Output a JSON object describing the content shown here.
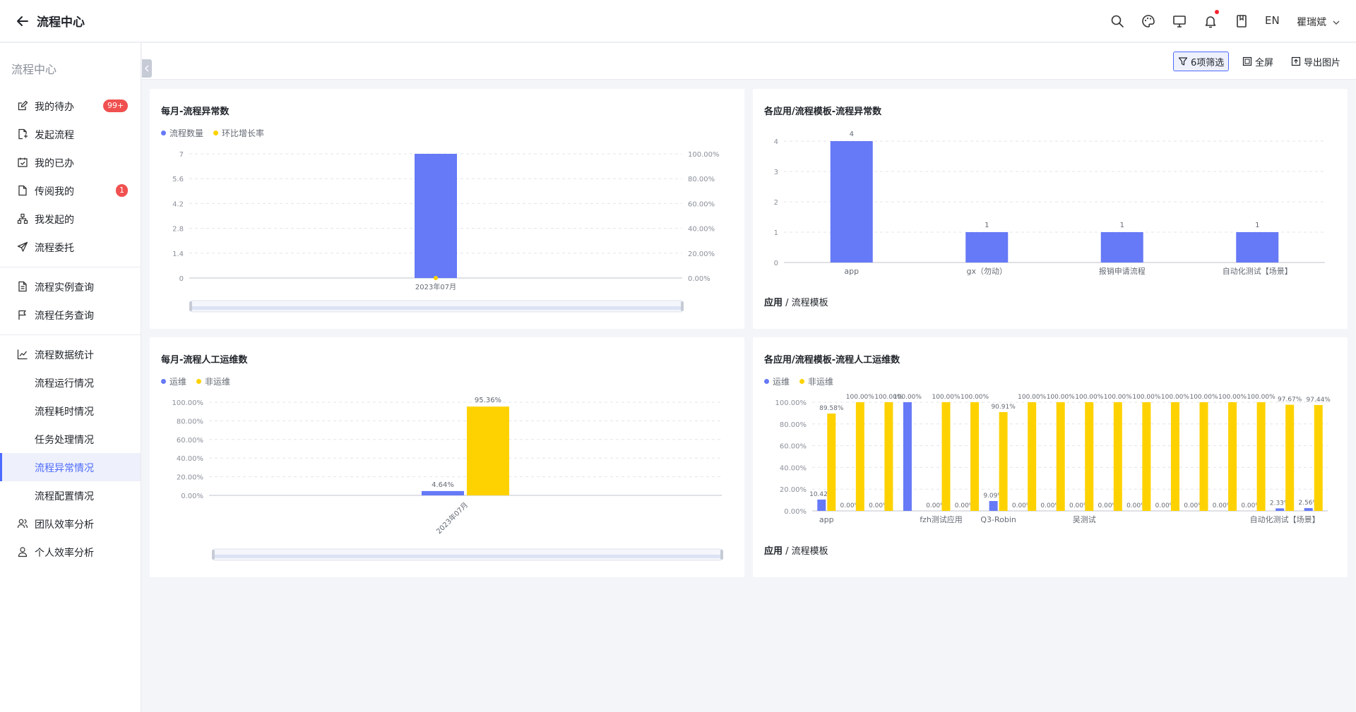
{
  "header": {
    "title": "流程中心",
    "lang": "EN",
    "user": "瞿瑞斌"
  },
  "sidebar": {
    "title": "流程中心",
    "items": [
      {
        "label": "我的待办",
        "badge": "99+",
        "icon": "edit-icon"
      },
      {
        "label": "发起流程",
        "icon": "file-start-icon"
      },
      {
        "label": "我的已办",
        "icon": "calendar-check-icon"
      },
      {
        "label": "传阅我的",
        "badge": "1",
        "icon": "document-icon"
      },
      {
        "label": "我发起的",
        "icon": "org-tree-icon"
      },
      {
        "label": "流程委托",
        "icon": "send-icon"
      },
      {
        "label": "流程实例查询",
        "icon": "doc-search-icon"
      },
      {
        "label": "流程任务查询",
        "icon": "flag-icon"
      },
      {
        "label": "流程数据统计",
        "icon": "line-chart-icon"
      },
      {
        "label": "流程运行情况"
      },
      {
        "label": "流程耗时情况"
      },
      {
        "label": "任务处理情况"
      },
      {
        "label": "流程异常情况"
      },
      {
        "label": "流程配置情况"
      },
      {
        "label": "团队效率分析",
        "icon": "team-icon"
      },
      {
        "label": "个人效率分析",
        "icon": "person-icon"
      }
    ]
  },
  "toolbar": {
    "filter_label": "6项筛选",
    "fullscreen_label": "全屏",
    "export_label": "导出图片"
  },
  "cards": {
    "c1": {
      "title": "每月-流程异常数",
      "legend": [
        "流程数量",
        "环比增长率"
      ]
    },
    "c2": {
      "title": "各应用/流程模板-流程异常数",
      "dim_bold": "应用",
      "dim_rest": " / 流程模板"
    },
    "c3": {
      "title": "每月-流程人工运维数",
      "legend": [
        "运维",
        "非运维"
      ]
    },
    "c4": {
      "title": "各应用/流程模板-流程人工运维数",
      "legend": [
        "运维",
        "非运维"
      ],
      "dim_bold": "应用",
      "dim_rest": " / 流程模板"
    }
  },
  "colors": {
    "accent": "#4d6bfe",
    "blue_series": "#6679f6",
    "yellow_series": "#fed200",
    "badge": "#f0504f"
  },
  "chart_data": [
    {
      "type": "bar",
      "title": "每月-流程异常数",
      "categories": [
        "2023年07月"
      ],
      "series": [
        {
          "name": "流程数量",
          "values": [
            7
          ]
        },
        {
          "name": "环比增长率",
          "values": [
            0
          ]
        }
      ],
      "y_ticks": [
        "0",
        "1.4",
        "2.8",
        "4.2",
        "5.6",
        "7"
      ],
      "y2_ticks": [
        "0.00%",
        "20.00%",
        "40.00%",
        "60.00%",
        "80.00%",
        "100.00%"
      ],
      "ylim": [
        0,
        7
      ]
    },
    {
      "type": "bar",
      "title": "各应用/流程模板-流程异常数",
      "categories": [
        "app",
        "gx（勿动）",
        "报销申请流程",
        "自动化测试【场景】"
      ],
      "values": [
        4,
        1,
        1,
        1
      ],
      "y_ticks": [
        "0",
        "1",
        "2",
        "3",
        "4"
      ],
      "ylim": [
        0,
        4
      ]
    },
    {
      "type": "bar",
      "title": "每月-流程人工运维数",
      "categories": [
        "2023年07月"
      ],
      "series": [
        {
          "name": "运维",
          "values": [
            4.64
          ],
          "labels": [
            "4.64%"
          ]
        },
        {
          "name": "非运维",
          "values": [
            95.36
          ],
          "labels": [
            "95.36%"
          ]
        }
      ],
      "y_ticks": [
        "0.00%",
        "20.00%",
        "40.00%",
        "60.00%",
        "80.00%",
        "100.00%"
      ],
      "ylim": [
        0,
        100
      ]
    },
    {
      "type": "bar",
      "title": "各应用/流程模板-流程人工运维数",
      "categories": [
        "app",
        "",
        "",
        "fzh测试应用",
        "",
        "",
        "Q3-Robin",
        "",
        "",
        "吴测试",
        "",
        "",
        "",
        "",
        "",
        "自动化测试【场景】",
        "",
        ""
      ],
      "x_tick_labels": [
        "app",
        "fzh测试应用",
        "Q3-Robin",
        "吴测试",
        "自动化测试【场景】"
      ],
      "series": [
        {
          "name": "运维",
          "values": [
            10.42,
            0,
            0,
            100,
            0,
            0,
            9.09,
            0,
            0,
            0,
            0,
            0,
            0,
            0,
            0,
            0,
            2.33,
            2.56
          ],
          "labels": [
            "10.42%",
            "0.00%",
            "0.00%",
            "100.00%",
            "0.00%",
            "0.00%",
            "9.09%",
            "0.00%",
            "0.00%",
            "0.00%",
            "0.00%",
            "0.00%",
            "0.00%",
            "0.00%",
            "0.00%",
            "0.00%",
            "2.33%",
            "2.56%"
          ]
        },
        {
          "name": "非运维",
          "values": [
            89.58,
            100,
            100,
            0,
            100,
            100,
            90.91,
            100,
            100,
            100,
            100,
            100,
            100,
            100,
            100,
            100,
            97.67,
            97.44
          ],
          "labels": [
            "89.58%",
            "100.00%",
            "100.00%",
            "",
            "100.00%",
            "100.00%",
            "90.91%",
            "100.00%",
            "100.00%",
            "100.00%",
            "100.00%",
            "100.00%",
            "100.00%",
            "100.00%",
            "100.00%",
            "100.00%",
            "97.67%",
            "97.44%"
          ]
        }
      ],
      "y_ticks": [
        "0.00%",
        "20.00%",
        "40.00%",
        "60.00%",
        "80.00%",
        "100.00%"
      ],
      "ylim": [
        0,
        100
      ]
    }
  ]
}
